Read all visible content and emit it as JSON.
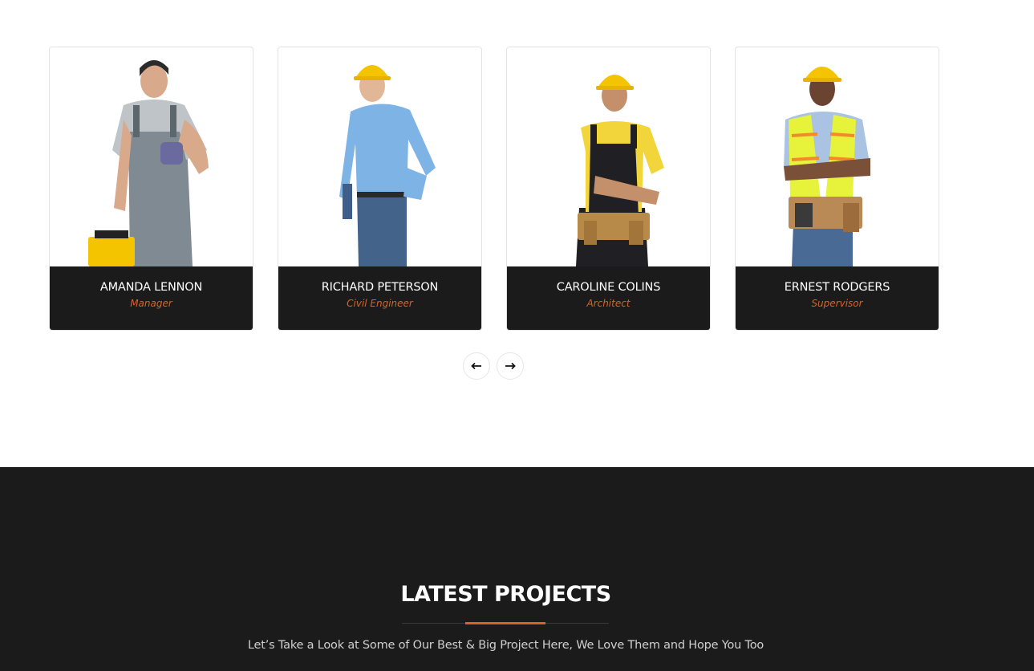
{
  "team": {
    "members": [
      {
        "name": "AMANDA LENNON",
        "role": "Manager"
      },
      {
        "name": "RICHARD PETERSON",
        "role": "Civil Engineer"
      },
      {
        "name": "CAROLINE COLINS",
        "role": "Architect"
      },
      {
        "name": "ERNEST RODGERS",
        "role": "Supervisor"
      }
    ],
    "prev_icon": "arrow-left-icon",
    "next_icon": "arrow-right-icon"
  },
  "projects": {
    "title": "LATEST PROJECTS",
    "subtitle": "Let’s Take a Look at Some of Our Best & Big Project Here, We Love Them and Hope You Too"
  },
  "colors": {
    "accent": "#d9622b",
    "dark": "#1b1b1b",
    "helmet": "#f5c400"
  }
}
